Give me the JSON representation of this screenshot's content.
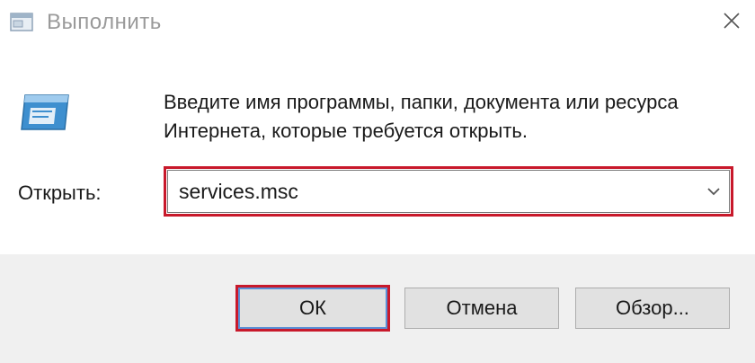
{
  "window": {
    "title": "Выполнить",
    "title_icon": "run-app-icon",
    "close_icon": "close-icon"
  },
  "main": {
    "run_icon": "run-dialog-icon",
    "instructions": "Введите имя программы, папки, документа или ресурса Интернета, которые требуется открыть.",
    "open_label": "Открыть:",
    "command_value": "services.msc",
    "dropdown_icon": "chevron-down-icon"
  },
  "buttons": {
    "ok": "ОК",
    "cancel": "Отмена",
    "browse": "Обзор..."
  },
  "colors": {
    "highlight": "#c8192b",
    "ok_border": "#5a8fd6",
    "footer_bg": "#f0f0f0",
    "title_text": "#9a9a9a"
  }
}
